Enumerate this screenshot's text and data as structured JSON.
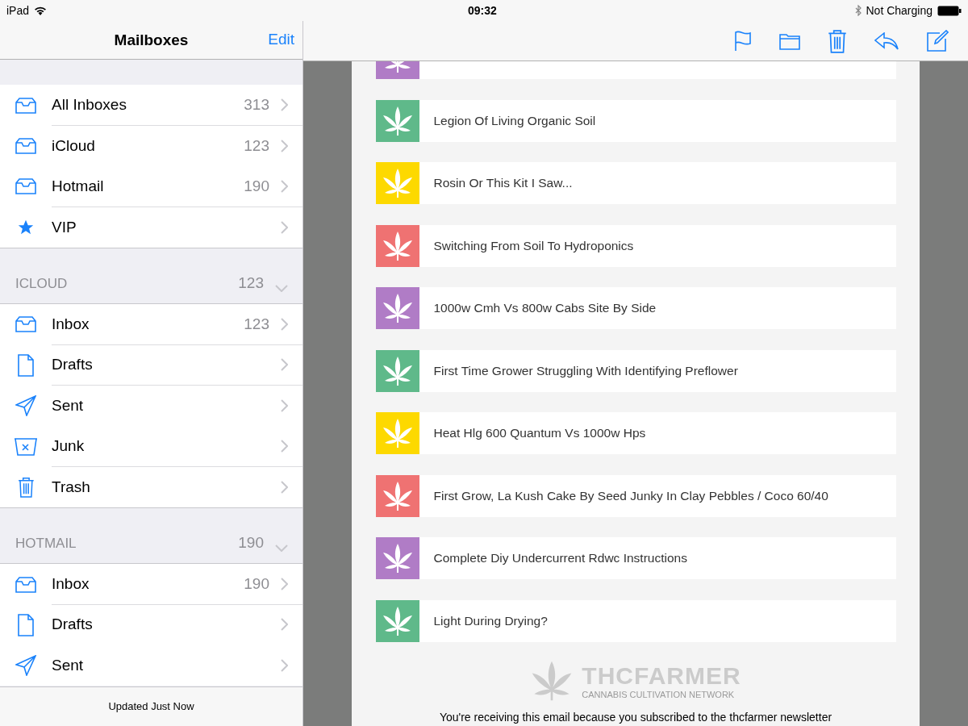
{
  "status_bar": {
    "device": "iPad",
    "time": "09:32",
    "battery_text": "Not Charging"
  },
  "sidebar": {
    "title": "Mailboxes",
    "edit": "Edit",
    "groups": [
      {
        "items": [
          {
            "kind": "inbox",
            "label": "All Inboxes",
            "count": "313"
          },
          {
            "kind": "inbox",
            "label": "iCloud",
            "count": "123"
          },
          {
            "kind": "inbox",
            "label": "Hotmail",
            "count": "190"
          },
          {
            "kind": "vip",
            "label": "VIP"
          }
        ]
      },
      {
        "header": "ICLOUD",
        "count": "123",
        "expanded": true,
        "items": [
          {
            "kind": "inbox",
            "label": "Inbox",
            "count": "123"
          },
          {
            "kind": "drafts",
            "label": "Drafts"
          },
          {
            "kind": "sent",
            "label": "Sent"
          },
          {
            "kind": "junk",
            "label": "Junk"
          },
          {
            "kind": "trash",
            "label": "Trash"
          }
        ]
      },
      {
        "header": "HOTMAIL",
        "count": "190",
        "expanded": true,
        "items": [
          {
            "kind": "inbox",
            "label": "Inbox",
            "count": "190"
          },
          {
            "kind": "drafts",
            "label": "Drafts"
          },
          {
            "kind": "sent",
            "label": "Sent"
          }
        ]
      }
    ],
    "footer": "Updated Just Now"
  },
  "email": {
    "partial_post": {
      "color": "#b07cc6"
    },
    "posts": [
      {
        "title": "Legion Of Living Organic Soil",
        "color": "#5fb98a"
      },
      {
        "title": "Rosin Or This Kit I Saw...",
        "color": "#fdd900"
      },
      {
        "title": "Switching From Soil To Hydroponics",
        "color": "#ef7272"
      },
      {
        "title": "1000w Cmh Vs 800w Cabs Site By Side",
        "color": "#b07cc6"
      },
      {
        "title": "First Time Grower Struggling With Identifying Preflower",
        "color": "#5fb98a"
      },
      {
        "title": "Heat Hlg 600 Quantum Vs 1000w Hps",
        "color": "#fdd900"
      },
      {
        "title": "First Grow, La Kush Cake By Seed Junky In Clay Pebbles / Coco 60/40",
        "color": "#ef7272"
      },
      {
        "title": "Complete Diy Undercurrent Rdwc Instructions",
        "color": "#b07cc6"
      },
      {
        "title": "Light During Drying?",
        "color": "#5fb98a"
      }
    ],
    "logo": {
      "name": "THCFARMER",
      "tagline": "CANNABIS CULTIVATION NETWORK"
    },
    "notice": "You're receiving this email because you subscribed to the thcfarmer newsletter"
  }
}
